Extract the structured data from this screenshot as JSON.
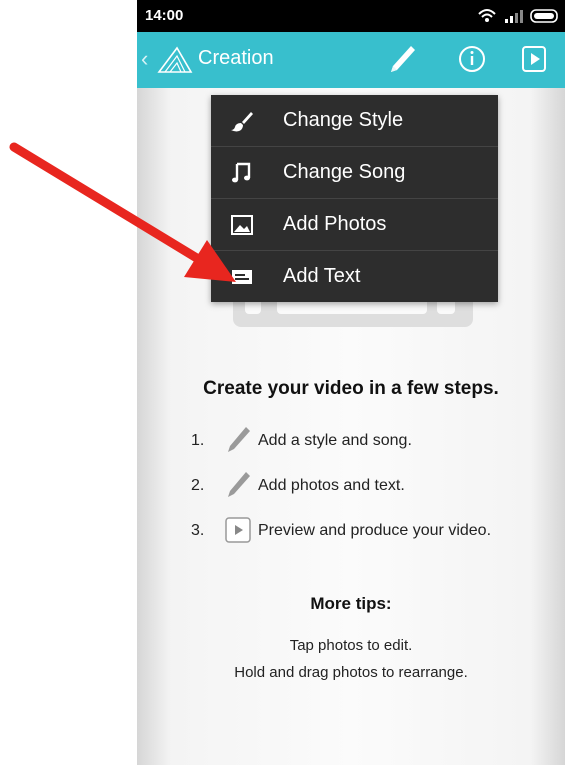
{
  "status_bar": {
    "time": "14:00"
  },
  "app_bar": {
    "back_glyph": "‹",
    "title": "Creation",
    "icons": [
      "logo-icon",
      "pencil-icon",
      "info-icon",
      "play-icon"
    ]
  },
  "menu": {
    "items": [
      {
        "label": "Change Style",
        "icon": "brush-icon"
      },
      {
        "label": "Change Song",
        "icon": "music-note-icon"
      },
      {
        "label": "Add Photos",
        "icon": "image-icon"
      },
      {
        "label": "Add Text",
        "icon": "text-card-icon"
      }
    ]
  },
  "instructions": {
    "heading": "Create your video in a few steps.",
    "steps": [
      {
        "number": "1.",
        "text": "Add a style and song.",
        "icon": "pencil-icon"
      },
      {
        "number": "2.",
        "text": "Add photos and text.",
        "icon": "pencil-icon"
      },
      {
        "number": "3.",
        "text": "Preview and produce your video.",
        "icon": "play-icon"
      }
    ]
  },
  "tips": {
    "title": "More tips:",
    "lines": [
      "Tap photos to edit.",
      "Hold and drag photos to rearrange."
    ]
  },
  "colors": {
    "app_bar": "#38bfcd",
    "menu_bg": "#2d2d2d",
    "annotation_arrow": "#e8261f"
  }
}
